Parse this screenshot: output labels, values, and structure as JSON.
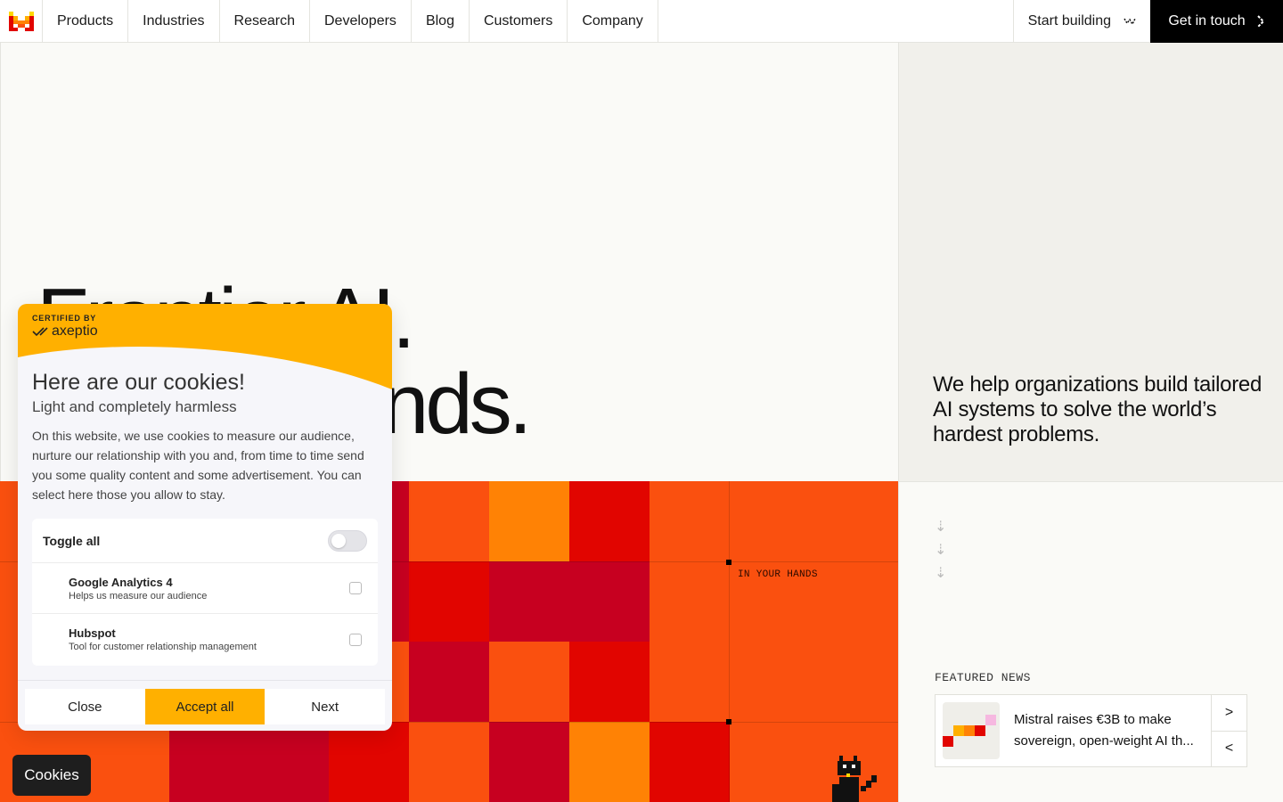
{
  "nav": {
    "logo": "mistral-logo",
    "items": [
      "Products",
      "Industries",
      "Research",
      "Developers",
      "Blog",
      "Customers",
      "Company"
    ],
    "start_building": "Start building",
    "get_in_touch": "Get in touch"
  },
  "hero": {
    "title_line1": "Frontier AI.",
    "title_line2": "In your hands.",
    "tagline": "We help organizations build tailored AI systems to solve the world’s hardest problems.",
    "grid_label": "IN YOUR HANDS"
  },
  "featured": {
    "label": "FEATURED NEWS",
    "headline": "Mistral raises €3B to make sovereign, open-weight AI th..."
  },
  "cookie": {
    "certified_by": "CERTIFIED BY",
    "brand": "axeptio",
    "title": "Here are our cookies!",
    "subtitle": "Light and completely harmless",
    "body": "On this website, we use cookies to measure our audience, nurture our relationship with you and, from time to time send you some quality content and some advertisement. You can select here those you allow to stay.",
    "toggle_all": "Toggle all",
    "vendors": [
      {
        "name": "Google Analytics 4",
        "desc": "Helps us measure our audience"
      },
      {
        "name": "Hubspot",
        "desc": "Tool for customer relationship management"
      }
    ],
    "close": "Close",
    "accept_all": "Accept all",
    "next": "Next"
  },
  "cookies_button": "Cookies",
  "colors": {
    "orange": "#fa500f",
    "red": "#e10500",
    "crimson": "#c70020",
    "amber": "#ff8205",
    "axeptio_yellow": "#ffb000"
  }
}
